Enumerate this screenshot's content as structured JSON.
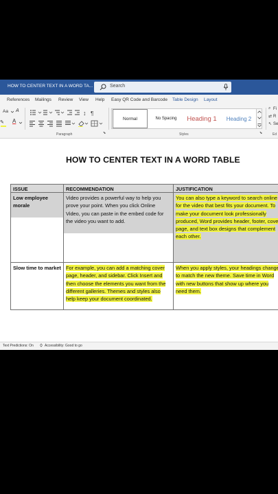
{
  "titlebar": {
    "doc_title": "HOW TO CENTER TEXT IN A WORD TA...",
    "search_placeholder": "Search"
  },
  "menu": [
    "References",
    "Mailings",
    "Review",
    "View",
    "Help",
    "Easy QR Code and Barcode",
    "Table Design",
    "Layout"
  ],
  "ribbon": {
    "font_size_label": "Aa",
    "paragraph_group": "Paragraph",
    "styles_group": "Styles",
    "editing_group": "Ed",
    "find_label": "Fi",
    "replace_label": "R",
    "select_label": "Se",
    "styles": [
      "Normal",
      "No Spacing",
      "Heading 1",
      "Heading 2"
    ]
  },
  "document": {
    "heading": "HOW TO CENTER TEXT IN A WORD TABLE",
    "table": {
      "headers": [
        "ISSUE",
        "RECOMMENDATION",
        "JUSTIFICATION"
      ],
      "rows": [
        {
          "issue": "Low employee morale",
          "recommendation": "Video provides a powerful way to help you prove your point. When you click Online Video, you can paste in the embed code for the video you want to add.",
          "justification": "You can also type a keyword to search online for the video that best fits your document. To make your document look professionally produced, Word provides header, footer, cover page, and text box designs that complement each other."
        },
        {
          "issue": "Slow time to market",
          "recommendation": "For example, you can add a matching cover page, header, and sidebar. Click Insert and then choose the elements you want from the different galleries. Themes and styles also help keep your document coordinated.",
          "justification": "When you apply styles, your headings change to match the new theme. Save time in Word with new buttons that show up where you need them."
        }
      ]
    }
  },
  "status": {
    "text_predictions": "Text Predictions: On",
    "accessibility": "Accessibility: Good to go"
  }
}
